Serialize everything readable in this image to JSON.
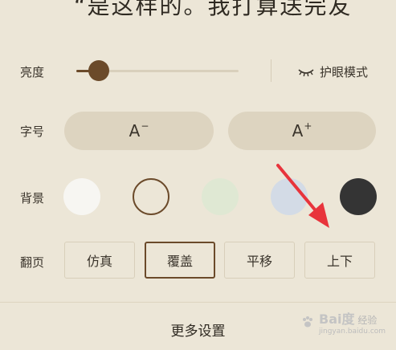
{
  "top_text": "“是这样的。我打算送完友",
  "brightness": {
    "label": "亮度",
    "level": 0.1
  },
  "eye_mode": {
    "label": "护眼模式",
    "icon": "closed-eye-icon"
  },
  "font_size": {
    "label": "字号",
    "decrease": {
      "letter": "A",
      "sign": "−"
    },
    "increase": {
      "letter": "A",
      "sign": "+"
    }
  },
  "background": {
    "label": "背景",
    "swatches": [
      {
        "name": "white",
        "color": "#f7f6f2",
        "selected": false
      },
      {
        "name": "beige",
        "color": "#ece6d7",
        "selected": true
      },
      {
        "name": "green",
        "color": "#dfe8d3",
        "selected": false
      },
      {
        "name": "blue",
        "color": "#d3dbe6",
        "selected": false
      },
      {
        "name": "dark",
        "color": "#343434",
        "selected": false
      }
    ]
  },
  "page_turn": {
    "label": "翻页",
    "options": [
      {
        "label": "仿真",
        "selected": false
      },
      {
        "label": "覆盖",
        "selected": true
      },
      {
        "label": "平移",
        "selected": false
      },
      {
        "label": "上下",
        "selected": false
      }
    ]
  },
  "more_settings": "更多设置",
  "watermark": {
    "brand": "Bai度",
    "sub": "经验",
    "url": "jingyan.baidu.com"
  },
  "colors": {
    "accent": "#6b4a2a",
    "arrow": "#e8343c",
    "panel": "#ece6d7"
  }
}
